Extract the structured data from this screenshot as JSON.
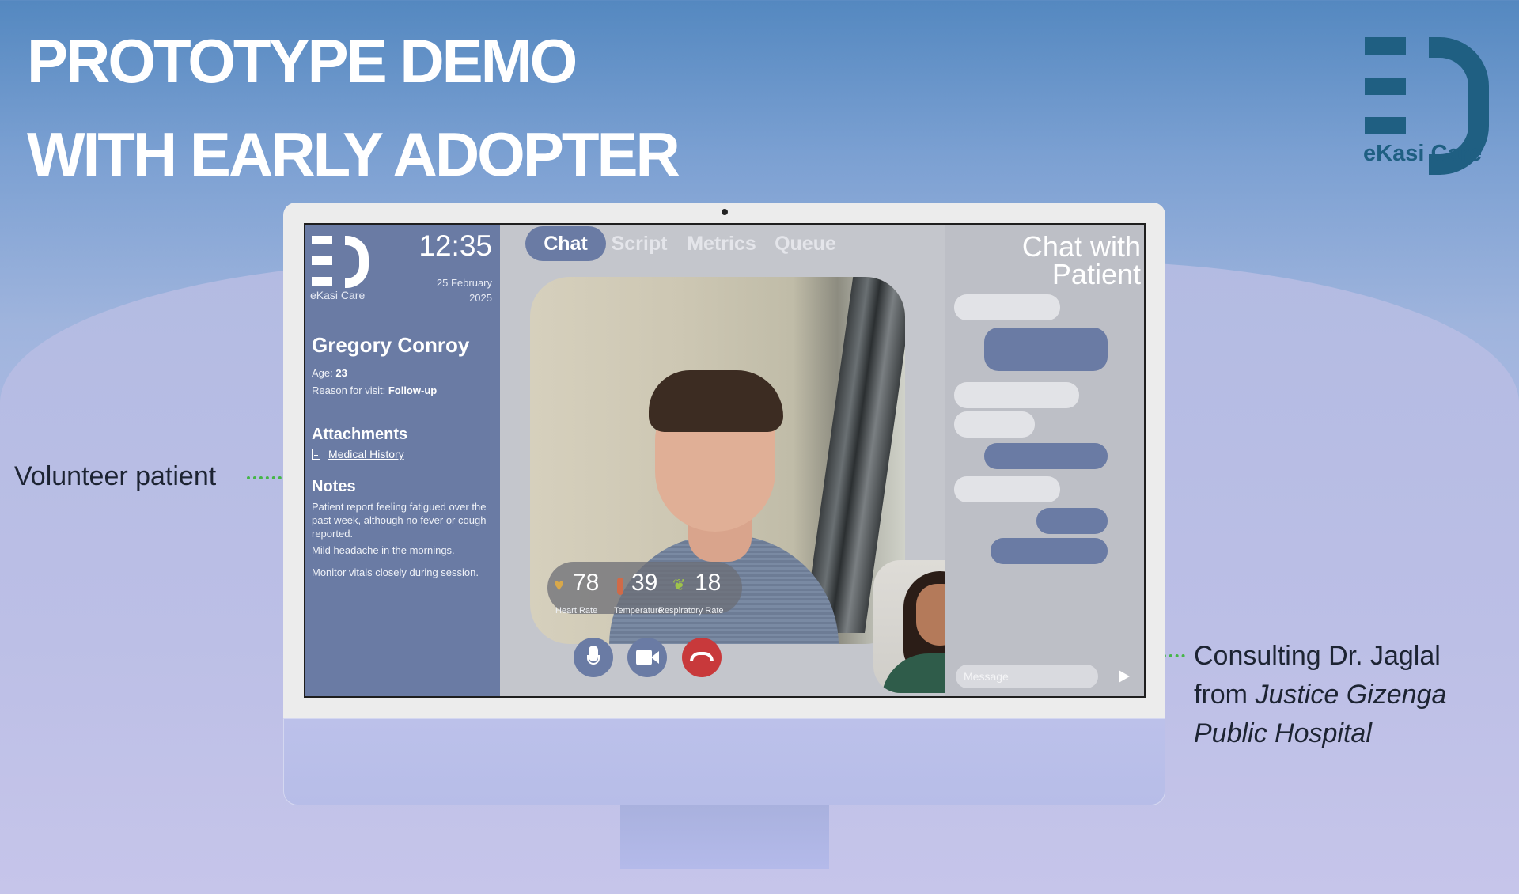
{
  "slide": {
    "title_line1": "PROTOTYPE DEMO",
    "title_line2": "WITH EARLY ADOPTER",
    "brand_name": "eKasi Care"
  },
  "annotations": {
    "left": "Volunteer patient",
    "right_line1": "Consulting Dr. Jaglal",
    "right_line2_prefix": "from ",
    "right_line2_em": "Justice Gizenga",
    "right_line3_em": "Public Hospital"
  },
  "app": {
    "brand": "eKasi Care",
    "time": "12:35",
    "date_line1": "25 February",
    "date_line2": "2025",
    "patient": {
      "name": "Gregory Conroy",
      "age_label": "Age:",
      "age": "23",
      "reason_label": "Reason for visit:",
      "reason": "Follow-up"
    },
    "attachments": {
      "heading": "Attachments",
      "items": [
        "Medical History"
      ]
    },
    "notes": {
      "heading": "Notes",
      "items": [
        "Patient report feeling fatigued over the past week, although no fever or cough reported.",
        "Mild headache in the mornings.",
        "Monitor vitals closely during session."
      ]
    },
    "tabs": [
      "Chat",
      "Script",
      "Metrics",
      "Queue"
    ],
    "active_tab": "Chat",
    "vitals": [
      {
        "value": "78",
        "label": "Heart Rate",
        "icon": "heart-icon"
      },
      {
        "value": "39",
        "label": "Temperature",
        "icon": "thermometer-icon"
      },
      {
        "value": "18",
        "label": "Respiratory Rate",
        "icon": "lungs-icon"
      }
    ],
    "chat": {
      "title_line1": "Chat with",
      "title_line2": "Patient",
      "message_placeholder": "Message"
    }
  },
  "colors": {
    "accent": "#6a7ba4",
    "brand": "#1f5f82",
    "end_call": "#c8393b",
    "arrow": "#46b649"
  }
}
